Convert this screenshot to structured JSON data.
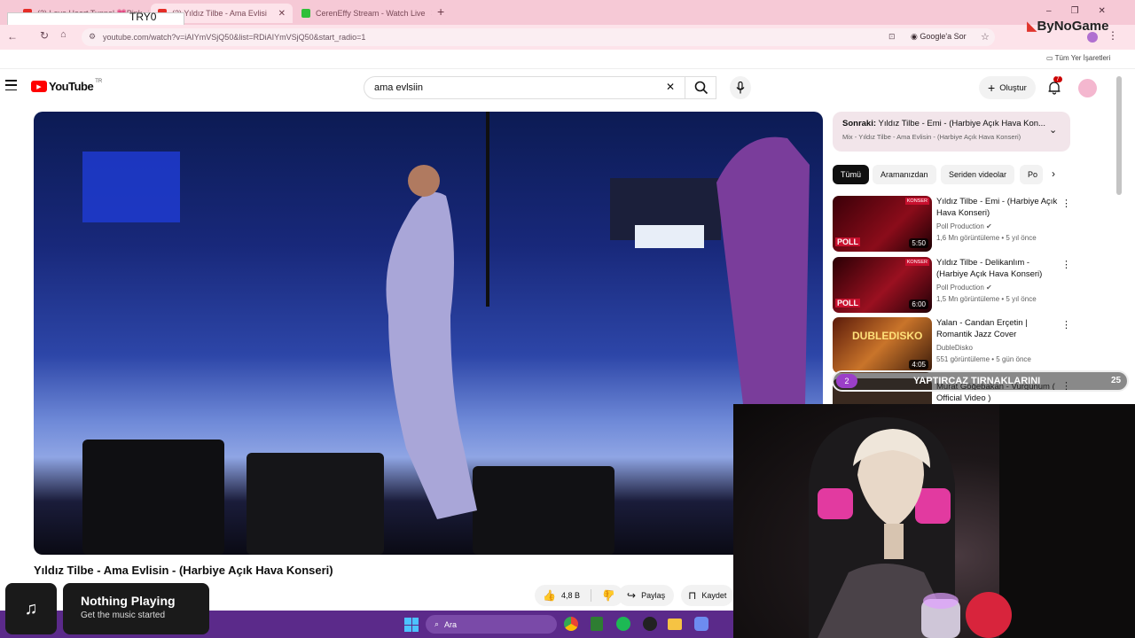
{
  "browser": {
    "tabs": [
      {
        "title": "(2) Love Heart Tunnel 💗Pink",
        "active": false
      },
      {
        "title": "(2) Yıldız Tilbe - Ama Evlisi",
        "active": true
      },
      {
        "title": "CerenEffy Stream - Watch Live",
        "active": false
      }
    ],
    "new_tab": "+",
    "url": "youtube.com/watch?v=iAIYmVSjQ50&list=RDiAIYmVSjQ50&start_radio=1",
    "google_label": "Google'a Sor",
    "bookmarks_label": "Tüm Yer İşaretleri",
    "window_controls": [
      "–",
      "❐",
      "✕"
    ]
  },
  "overlay": {
    "try_rate": "TRY0 (0.00%)",
    "brand": "ByNoGame",
    "subtitle_number": "2",
    "subtitle_text": "YAPTIRCAZ TIRNAKLARINI",
    "subtitle_count": "25"
  },
  "youtube": {
    "logo_text": "YouTube",
    "region": "TR",
    "search_value": "ama evlsiin",
    "create_label": "Oluştur",
    "notification_count": "7",
    "up_next_prefix": "Sonraki:",
    "up_next_title": "Yıldız Tilbe - Emi - (Harbiye Açık Hava Kon...",
    "up_next_mix": "Mix - Yıldız Tilbe - Ama Evlisin - (Harbiye Açık Hava Konseri)",
    "chips": [
      "Tümü",
      "Aramanızdan",
      "Seriden videolar",
      "Po"
    ],
    "recommendations": [
      {
        "title": "Yıldız Tilbe - Emi - (Harbiye Açık Hava Konseri)",
        "channel": "Poll Production",
        "meta": "1,6 Mn görüntüleme • 5 yıl önce",
        "duration": "5:50",
        "badge": "KONSER"
      },
      {
        "title": "Yıldız Tilbe - Delikanlım - (Harbiye Açık Hava Konseri)",
        "channel": "Poll Production",
        "meta": "1,5 Mn görüntüleme • 5 yıl önce",
        "duration": "6:00",
        "badge": "KONSER"
      },
      {
        "title": "Yalan - Candan Erçetin | Romantik Jazz Cover",
        "channel": "DubleDisko",
        "meta": "551 görüntüleme • 5 gün önce",
        "duration": "4:05",
        "badge": ""
      },
      {
        "title": "Murat Göğebakan - Vurgunum ( Official Video )",
        "channel": "",
        "meta": "",
        "duration": "",
        "badge": ""
      }
    ],
    "video_title": "Yıldız Tilbe - Ama Evlisin - (Harbiye Açık Hava Konseri)",
    "likes": "4,8 B",
    "share_label": "Paylaş",
    "save_label": "Kaydet"
  },
  "music_widget": {
    "title": "Nothing Playing",
    "subtitle": "Get the music started"
  },
  "taskbar": {
    "search_label": "Ara"
  },
  "colors": {
    "tabbar": "#f6c9d6",
    "yt_red": "#ff0000",
    "taskbar": "#5b2a8a",
    "upnext_bg": "#f2e5ea"
  }
}
